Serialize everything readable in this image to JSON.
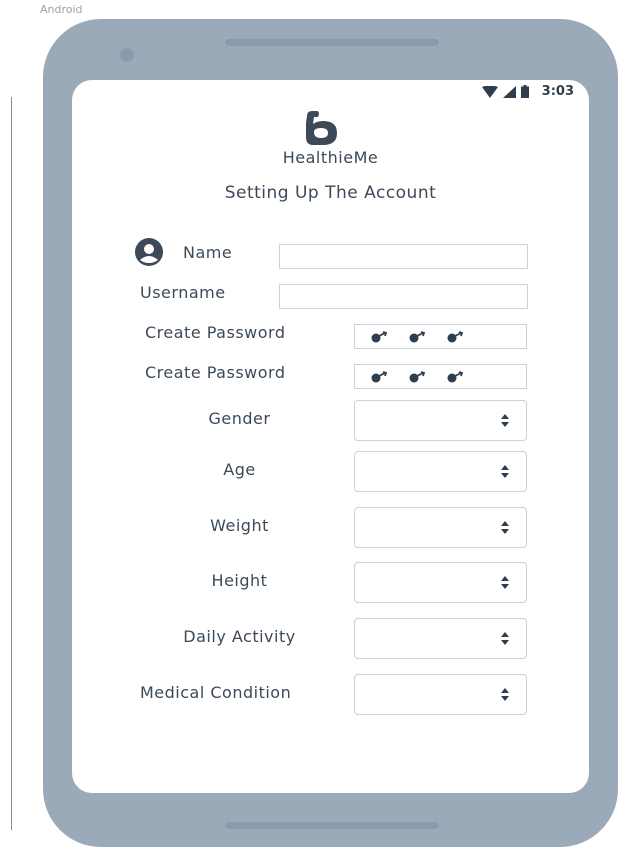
{
  "frame": {
    "label": "Android"
  },
  "status_bar": {
    "time": "3:03",
    "icons": [
      "wifi-icon",
      "signal-icon",
      "battery-icon"
    ]
  },
  "app": {
    "name": "HealthieMe",
    "logo_icon": "flexed-arm-icon"
  },
  "page": {
    "title": "Setting Up The Account"
  },
  "form": {
    "name": {
      "label": "Name",
      "value": "",
      "icon": "user-icon"
    },
    "username": {
      "label": "Username",
      "value": ""
    },
    "password": {
      "label": "Create Password",
      "mask_icon": "key-icon"
    },
    "password_confirm": {
      "label": "Create Password",
      "mask_icon": "key-icon"
    },
    "gender": {
      "label": "Gender",
      "selected": ""
    },
    "age": {
      "label": "Age",
      "selected": ""
    },
    "weight": {
      "label": "Weight",
      "selected": ""
    },
    "height": {
      "label": "Height",
      "selected": ""
    },
    "daily_activity": {
      "label": "Daily Activity",
      "selected": ""
    },
    "medical_condition": {
      "label": "Medical Condition",
      "selected": ""
    }
  },
  "colors": {
    "device_frame": "#9baab8",
    "text": "#3c4a58",
    "input_border": "#c9d1d9",
    "screen_bg": "#ffffff"
  }
}
